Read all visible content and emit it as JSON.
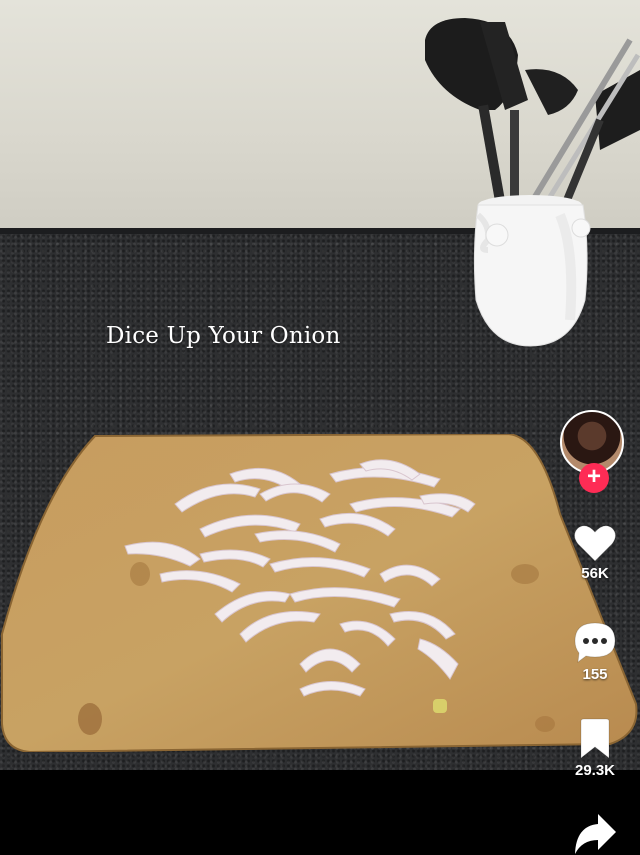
{
  "video": {
    "caption": "Dice Up Your Onion"
  },
  "creator": {
    "follow_label": "+"
  },
  "actions": {
    "likes": "56K",
    "comments": "155",
    "saves": "29.3K"
  },
  "icons": {
    "like": "heart-icon",
    "comment": "comment-icon",
    "save": "bookmark-icon",
    "share": "share-icon"
  },
  "colors": {
    "follow_accent": "#fe2c55"
  }
}
